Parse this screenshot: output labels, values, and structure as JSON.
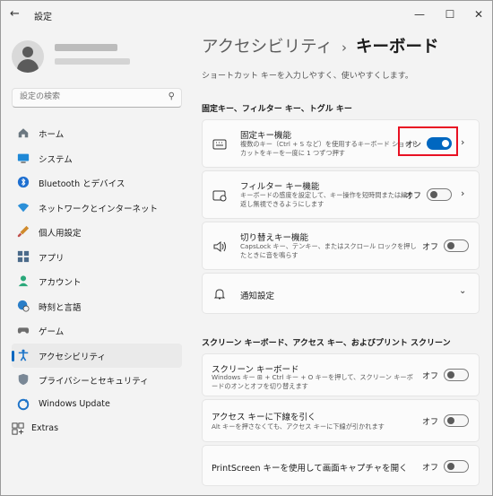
{
  "window": {
    "title": "設定"
  },
  "search": {
    "placeholder": "設定の検索"
  },
  "sidebar": {
    "items": [
      {
        "label": "ホーム",
        "icon": "home-icon"
      },
      {
        "label": "システム",
        "icon": "system-icon"
      },
      {
        "label": "Bluetooth とデバイス",
        "icon": "bluetooth-icon"
      },
      {
        "label": "ネットワークとインターネット",
        "icon": "network-icon"
      },
      {
        "label": "個人用設定",
        "icon": "brush-icon"
      },
      {
        "label": "アプリ",
        "icon": "apps-icon"
      },
      {
        "label": "アカウント",
        "icon": "account-icon"
      },
      {
        "label": "時刻と言語",
        "icon": "globe-clock-icon"
      },
      {
        "label": "ゲーム",
        "icon": "gamepad-icon"
      },
      {
        "label": "アクセシビリティ",
        "icon": "accessibility-icon"
      },
      {
        "label": "プライバシーとセキュリティ",
        "icon": "shield-icon"
      },
      {
        "label": "Windows Update",
        "icon": "update-icon"
      }
    ],
    "active_index": 9,
    "extras": "Extras"
  },
  "breadcrumb": {
    "parent": "アクセシビリティ",
    "separator": "›",
    "current": "キーボード"
  },
  "description": "ショートカット キーを入力しやすく、使いやすくします。",
  "section1": "固定キー、フィルター キー、トグル キー",
  "section2": "スクリーン キーボード、アクセス キー、およびプリント スクリーン",
  "cards": {
    "sticky": {
      "title": "固定キー機能",
      "subtitle": "複数のキー（Ctrl + S など）を使用するキーボード ショートカットをキーを一度に 1 つずつ押す",
      "state": "オン",
      "on": true
    },
    "filter": {
      "title": "フィルター キー機能",
      "subtitle": "キーボードの感度を設定して、キー操作を短時間または繰り返し無視できるようにします",
      "state": "オフ",
      "on": false
    },
    "toggle": {
      "title": "切り替えキー機能",
      "subtitle": "CapsLock キー、テンキー、またはスクロール ロックを押したときに音を鳴らす",
      "state": "オフ",
      "on": false
    },
    "notify": {
      "title": "通知設定"
    },
    "osk": {
      "title": "スクリーン キーボード",
      "subtitle": "Windows キー ⊞ + Ctrl キー + O キーを押して、スクリーン キーボードのオンとオフを切り替えます",
      "state": "オフ",
      "on": false
    },
    "access": {
      "title": "アクセス キーに下線を引く",
      "subtitle": "Alt キーを押さなくても、アクセス キーに下線が引かれます",
      "state": "オフ",
      "on": false
    },
    "prtsc": {
      "title": "PrintScreen キーを使用して画面キャプチャを開く",
      "state": "オフ",
      "on": false
    }
  },
  "colors": {
    "accent": "#0067c0",
    "highlight": "#e81123"
  }
}
